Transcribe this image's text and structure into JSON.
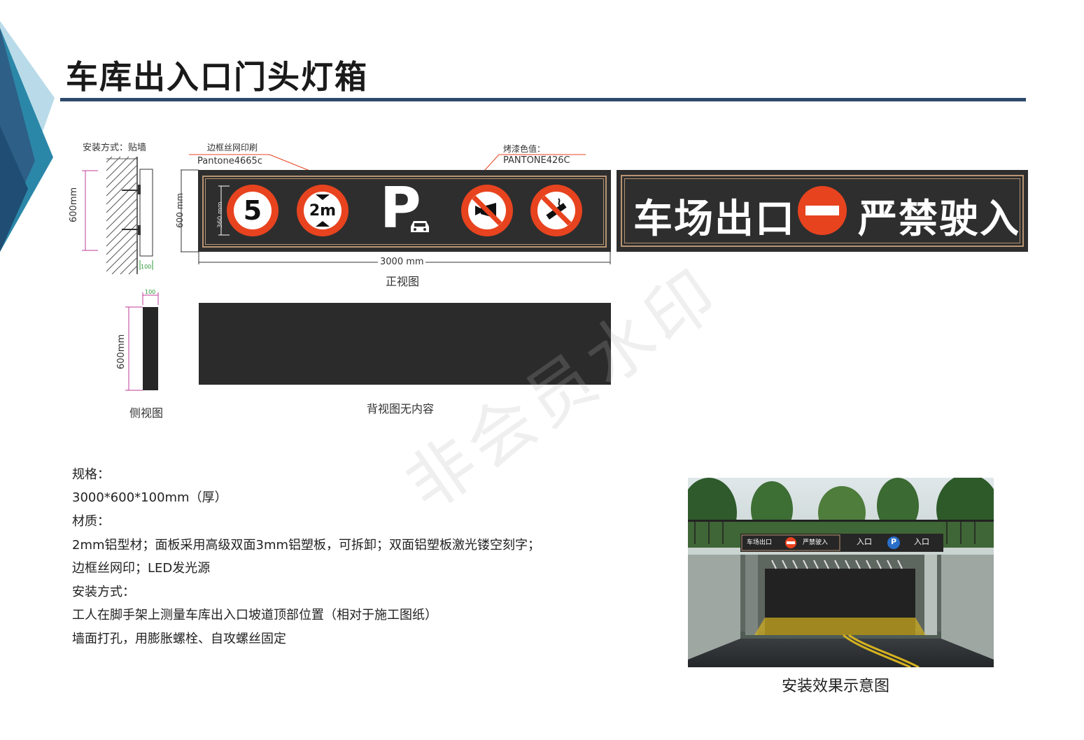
{
  "header": {
    "title": "车库出入口门头灯箱"
  },
  "drawing": {
    "install_method_label": "安装方式：贴墙",
    "side_dim_height": "600mm",
    "side_dim_depth": "100",
    "front_dim_height": "600 mm",
    "sign_height_dim": "360 mm",
    "border_print_label": "边框丝网印刷",
    "border_pantone": "Pantone4665c",
    "paint_color_label": "烤漆色值：",
    "paint_pantone": "PANTONE426C",
    "width_dim": "3000 mm",
    "front_view_caption": "正视图",
    "side_depth_dim": "100",
    "side_height_dim": "600mm",
    "side_view_caption": "侧视图",
    "back_view_caption": "背视图无内容",
    "front_sign": {
      "speed_limit": "5",
      "height_limit": "2m",
      "parking_letter": "P"
    },
    "display_sign": {
      "left_text": "车场出口",
      "right_text": "严禁驶入"
    }
  },
  "spec": {
    "lines": [
      "规格：",
      "3000*600*100mm（厚）",
      "材质：",
      "2mm铝型材；面板采用高级双面3mm铝塑板，可拆卸；双面铝塑板激光镂空刻字；",
      "边框丝网印；LED发光源",
      "安装方式：",
      "工人在脚手架上测量车库出入口坡道顶部位置（相对于施工图纸）",
      "墙面打孔，用膨胀螺栓、自攻螺丝固定"
    ]
  },
  "render": {
    "sign_exit": "车场出口",
    "sign_no_entry": "严禁驶入",
    "sign_entrance_1": "入口",
    "sign_parking": "P",
    "sign_entrance_2": "入口",
    "caption": "安装效果示意图"
  },
  "watermark": "非会员水印",
  "colors": {
    "accent_navy": "#2d4a6b",
    "sign_red": "#e8431f",
    "sign_bg": "#2e2e2e",
    "frame_gold": "#b89472"
  }
}
